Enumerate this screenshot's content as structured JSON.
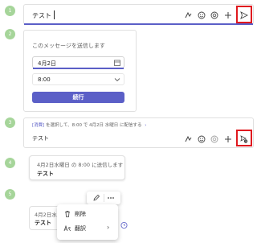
{
  "steps": [
    "1",
    "2",
    "3",
    "4",
    "5"
  ],
  "compose": {
    "text": "テスト"
  },
  "schedule_panel": {
    "title": "このメッセージを送信します",
    "date_value": "4月2日",
    "time_value": "8:00",
    "continue_label": "続行"
  },
  "scheduled_compose": {
    "hint_link": "[消費]",
    "hint_text": " を選択して、8:00 で 4月2日 水曜日 に配信する",
    "hint_chevron": "›",
    "text": "テスト"
  },
  "scheduled_message": {
    "meta": "4月2日水曜日 の 8:00 に送信します",
    "text": "テスト"
  },
  "context_example": {
    "meta": "4月2日水",
    "text": "テスト",
    "menu": {
      "items": [
        {
          "label": "削除"
        },
        {
          "label": "翻訳",
          "submenu": "›"
        }
      ]
    }
  },
  "colors": {
    "accent": "#5b5fc7",
    "step": "#a6d59a",
    "highlight": "#e0191f"
  },
  "icons": [
    "format-icon",
    "emoji-icon",
    "loop-icon",
    "plus-icon",
    "send-icon",
    "calendar-icon",
    "chevron-down-icon",
    "schedule-send-icon",
    "edit-icon",
    "more-icon",
    "trash-icon",
    "translate-icon",
    "clock-icon"
  ]
}
